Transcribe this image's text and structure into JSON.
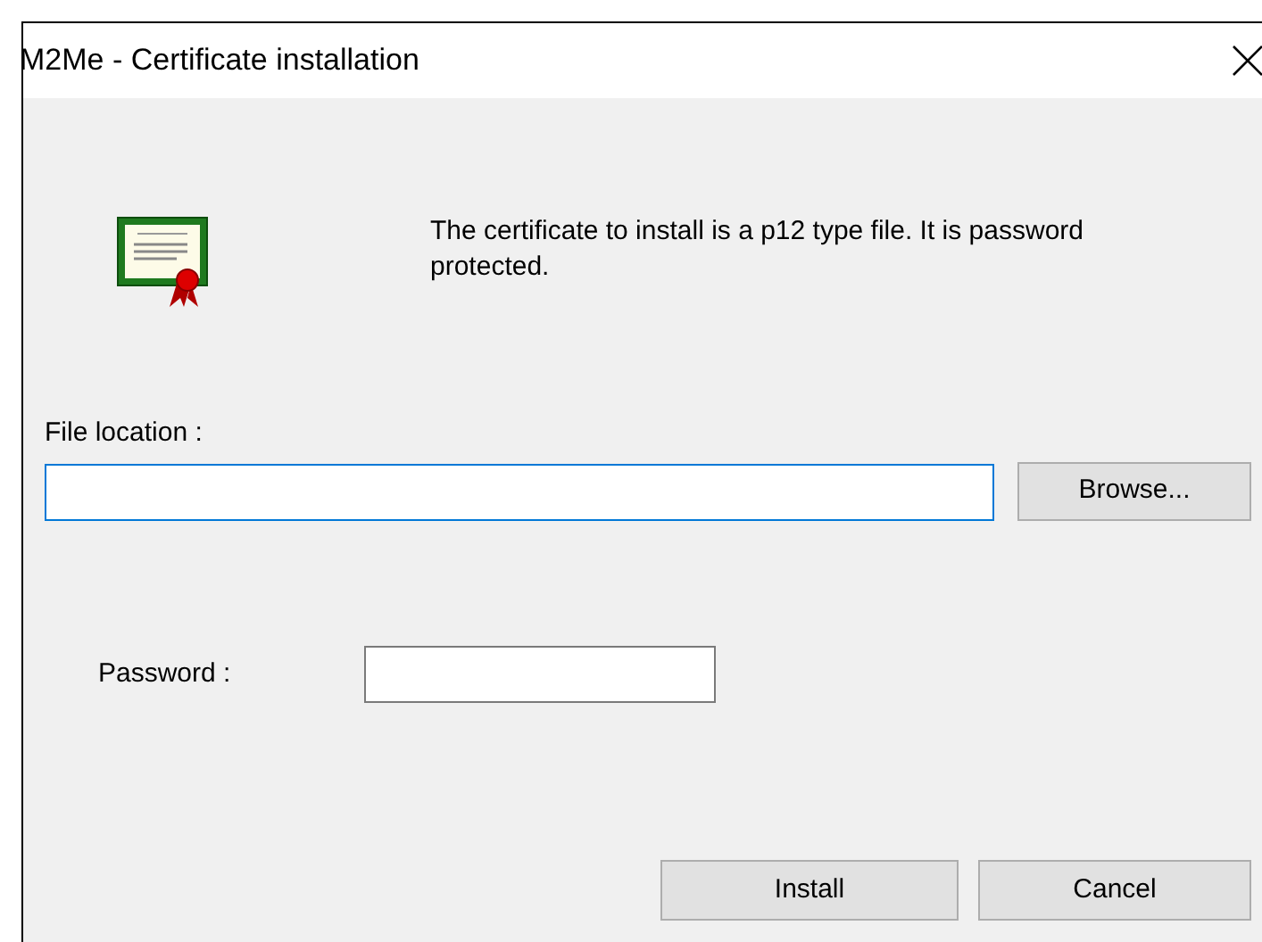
{
  "window": {
    "title": "M2Me - Certificate installation"
  },
  "message": "The certificate to install is a p12 type file. It is password protected.",
  "file_location": {
    "label": "File location :",
    "focused": true
  },
  "browse_button": "Browse...",
  "password": {
    "label": "Password :",
    "focused": false
  },
  "buttons": [
    "Install",
    "Cancel"
  ]
}
